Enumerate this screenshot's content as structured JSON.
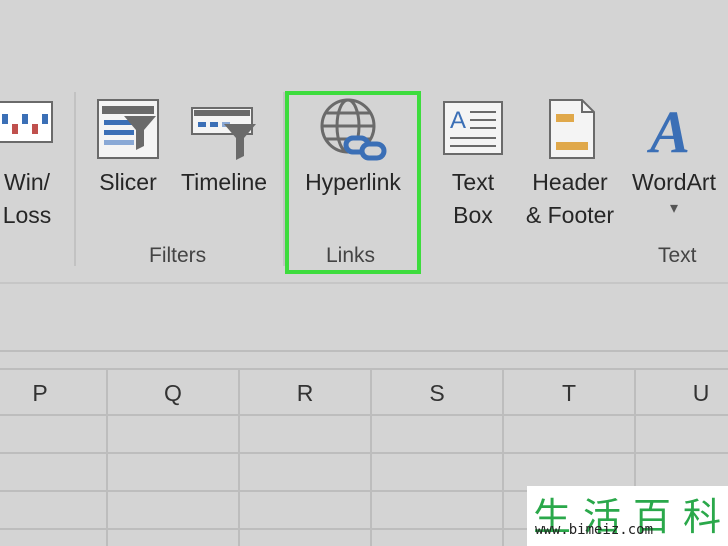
{
  "ribbon": {
    "buttons": {
      "winloss": {
        "line1": "Win/",
        "line2": "Loss"
      },
      "slicer": {
        "label": "Slicer"
      },
      "timeline": {
        "label": "Timeline"
      },
      "hyperlink": {
        "label": "Hyperlink"
      },
      "textbox": {
        "line1": "Text",
        "line2": "Box"
      },
      "header_footer": {
        "line1": "Header",
        "line2": "& Footer"
      },
      "wordart": {
        "label": "WordArt",
        "dropdown": "▾"
      }
    },
    "groups": {
      "filters": "Filters",
      "links": "Links",
      "text": "Text"
    },
    "highlight_color": "#3ddc3d"
  },
  "grid": {
    "columns": [
      "P",
      "Q",
      "R",
      "S",
      "T",
      "U"
    ]
  },
  "watermark": {
    "chars": [
      "生",
      "活",
      "百",
      "科"
    ],
    "url": "www.bimeiz.com"
  }
}
